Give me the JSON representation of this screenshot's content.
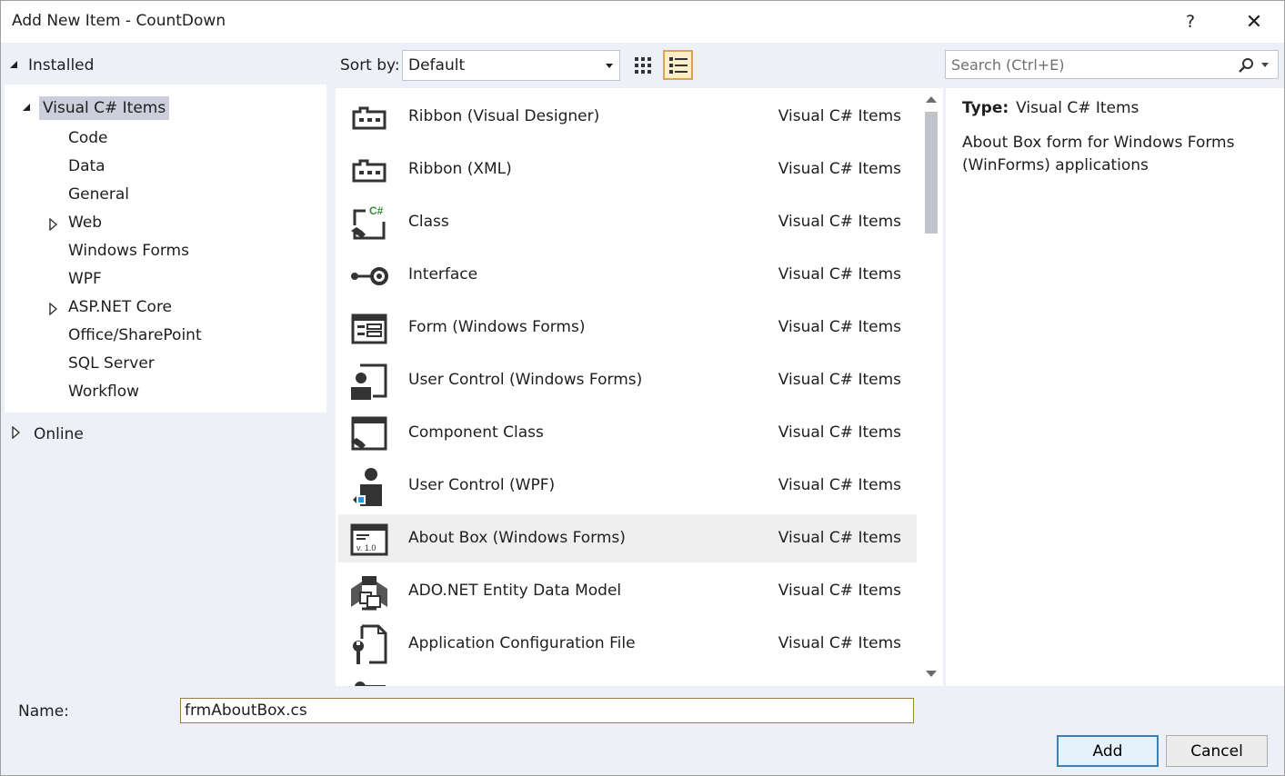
{
  "window": {
    "title": "Add New Item - CountDown",
    "help_label": "?",
    "close_label": "✕"
  },
  "tree": {
    "installed_label": "Installed",
    "root_label": "Visual C# Items",
    "children": [
      {
        "label": "Code",
        "expandable": false
      },
      {
        "label": "Data",
        "expandable": false
      },
      {
        "label": "General",
        "expandable": false
      },
      {
        "label": "Web",
        "expandable": true
      },
      {
        "label": "Windows Forms",
        "expandable": false
      },
      {
        "label": "WPF",
        "expandable": false
      },
      {
        "label": "ASP.NET Core",
        "expandable": true
      },
      {
        "label": "Office/SharePoint",
        "expandable": false
      },
      {
        "label": "SQL Server",
        "expandable": false
      },
      {
        "label": "Workflow",
        "expandable": false
      }
    ],
    "online_label": "Online"
  },
  "toolbar": {
    "sort_label": "Sort by:",
    "sort_value": "Default",
    "search_placeholder": "Search (Ctrl+E)"
  },
  "items": [
    {
      "name": "Ribbon (Visual Designer)",
      "category": "Visual C# Items",
      "icon": "ribbon-icon"
    },
    {
      "name": "Ribbon (XML)",
      "category": "Visual C# Items",
      "icon": "ribbon-icon"
    },
    {
      "name": "Class",
      "category": "Visual C# Items",
      "icon": "class-icon"
    },
    {
      "name": "Interface",
      "category": "Visual C# Items",
      "icon": "interface-icon"
    },
    {
      "name": "Form (Windows Forms)",
      "category": "Visual C# Items",
      "icon": "form-icon"
    },
    {
      "name": "User Control (Windows Forms)",
      "category": "Visual C# Items",
      "icon": "user-control-icon"
    },
    {
      "name": "Component Class",
      "category": "Visual C# Items",
      "icon": "component-class-icon"
    },
    {
      "name": "User Control (WPF)",
      "category": "Visual C# Items",
      "icon": "wpf-user-control-icon"
    },
    {
      "name": "About Box (Windows Forms)",
      "category": "Visual C# Items",
      "icon": "about-box-icon",
      "selected": true
    },
    {
      "name": "ADO.NET Entity Data Model",
      "category": "Visual C# Items",
      "icon": "entity-model-icon"
    },
    {
      "name": "Application Configuration File",
      "category": "Visual C# Items",
      "icon": "config-file-icon"
    }
  ],
  "details": {
    "type_label": "Type:",
    "type_value": "Visual C# Items",
    "description": "About Box form for Windows Forms (WinForms) applications"
  },
  "bottom": {
    "name_label": "Name:",
    "name_value": "frmAboutBox.cs",
    "add_label": "Add",
    "cancel_label": "Cancel"
  },
  "icon_texts": {
    "class_badge": "C#",
    "about_version": "v. 1.0"
  }
}
